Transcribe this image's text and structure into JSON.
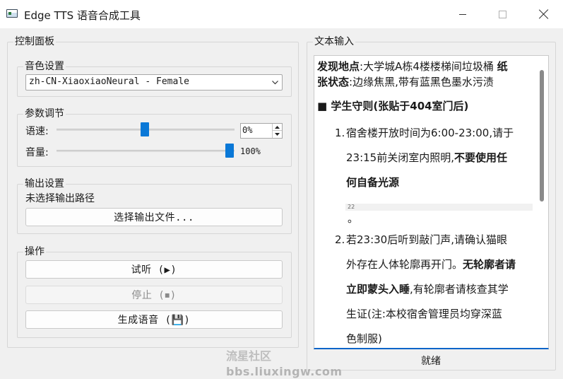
{
  "window": {
    "title": "Edge TTS 语音合成工具"
  },
  "control_panel": {
    "title": "控制面板",
    "voice_group": {
      "title": "音色设置",
      "selected_voice": "zh-CN-XiaoxiaoNeural - Female"
    },
    "params_group": {
      "title": "参数调节",
      "rate_label": "语速:",
      "rate_value": "0%",
      "rate_level": 0.5,
      "volume_label": "音量:",
      "volume_value": "100%",
      "volume_level": 1.0
    },
    "output_group": {
      "title": "输出设置",
      "path_text": "未选择输出路径",
      "choose_button": "选择输出文件..."
    },
    "actions_group": {
      "title": "操作",
      "preview_button": "试听 (▶)",
      "stop_button": "停止 (⏹)",
      "generate_button": "生成语音 (💾)"
    }
  },
  "text_input": {
    "title": "文本输入",
    "line1_bold": "发现地点",
    "line1_rest": ":大学城A栋4楼楼梯间垃圾桶",
    "line1_tail_bold": "纸",
    "line2_bold": "张状态",
    "line2_rest": ":边缘焦黑,带有蓝黑色墨水污渍",
    "rules_heading": "■ 学生守则(张贴于404室门后)",
    "item1_num": "1.",
    "item1_a": "宿舍楼开放时间为6:00-23:00,请于",
    "item1_b": "23:15前关闭室内照明,",
    "item1_bold_a": "不要使用任",
    "item1_bold_b": "何自备光源",
    "code_bar": "22",
    "period": "。",
    "item2_num": "2.",
    "item2_a": "若23:30后听到敲门声,请确认猫眼",
    "item2_b": "外存在人体轮廓再开门。",
    "item2_bold_a": "无轮廓者请",
    "item2_bold_b": "立即蒙头入睡",
    "item2_c": ",有轮廓者请核查其学",
    "item2_d": "生证(注:本校宿舍管理员均穿深蓝",
    "item2_e": "色制服)"
  },
  "status_bar": {
    "text": "就绪"
  },
  "watermark": {
    "line1": "流星社区",
    "line2": "bbs.liuxingw.com"
  },
  "colors": {
    "accent": "#0a78d7",
    "focus_border": "#0a64c8"
  }
}
